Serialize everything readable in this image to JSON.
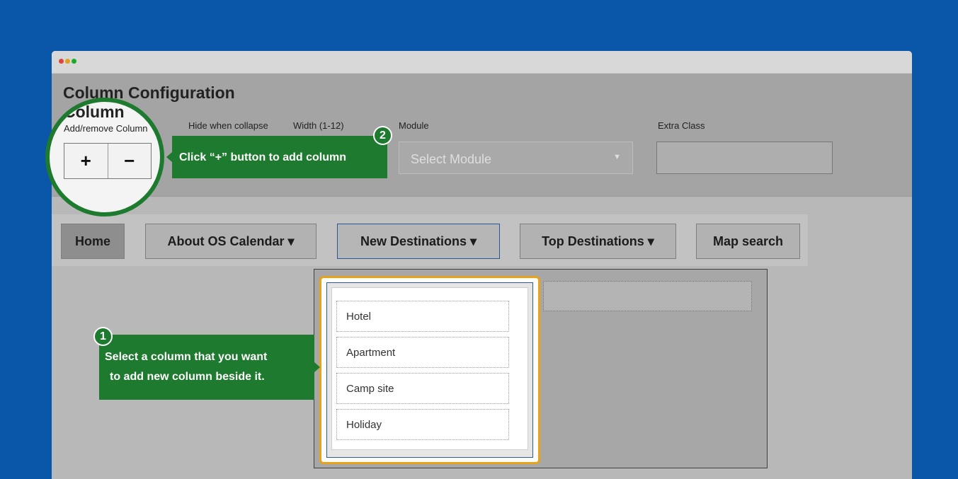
{
  "config": {
    "title": "Column Configuration",
    "labels": {
      "add_remove": "Add/remove Column",
      "hide_collapse": "Hide when collapse",
      "width": "Width (1-12)",
      "module": "Module",
      "extra_class": "Extra Class"
    },
    "select_module_placeholder": "Select Module",
    "plus_label": "+",
    "minus_label": "−",
    "extra_class_value": ""
  },
  "nav": {
    "items": [
      {
        "label": "Home"
      },
      {
        "label": "About OS Calendar ▾"
      },
      {
        "label": "New Destinations ▾"
      },
      {
        "label": "Top Destinations ▾"
      },
      {
        "label": "Map search"
      }
    ]
  },
  "dropdown": {
    "items": [
      "Hotel",
      "Apartment",
      "Camp site",
      "Holiday"
    ]
  },
  "tooltips": {
    "step1_number": "1",
    "step1_line1": "Select a column that you want",
    "step1_line2": "to add new column beside it.",
    "step2_number": "2",
    "step2_text": "Click “+” button to add column"
  },
  "colors": {
    "background": "#0a56a8",
    "tooltip_green": "#1e7a2e",
    "selection_orange": "#e8a317"
  }
}
